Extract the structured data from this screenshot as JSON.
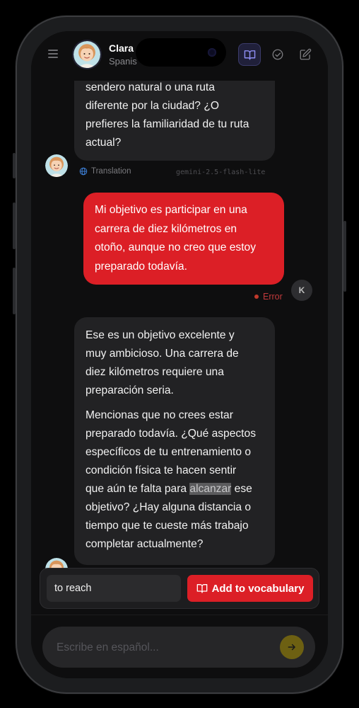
{
  "header": {
    "name": "Clara",
    "subtitle": "Spanis"
  },
  "messages": {
    "bot1": {
      "lines": [
        "sendero natural o una ruta",
        "diferente por la ciudad? ¿O",
        "prefieres la familiaridad de tu ruta",
        "actual?"
      ],
      "translation_label": "Translation",
      "model": "gemini-2.5-flash-lite"
    },
    "user1": {
      "lines": [
        "Mi objetivo es participar en una",
        "carrera de diez kilómetros en",
        "otoño, aunque no creo que estoy",
        "preparado todavía."
      ],
      "status": "Error",
      "avatar_initial": "K"
    },
    "bot2": {
      "paragraph1": [
        "Ese es un objetivo excelente y",
        "muy ambicioso. Una carrera de",
        "diez kilómetros requiere una",
        "preparación seria."
      ],
      "paragraph2_lines": [
        "Mencionas que no crees estar",
        "preparado todavía. ¿Qué aspectos",
        "específicos de tu entrenamiento o",
        "condición física te hacen sentir"
      ],
      "line_hl_before": "que aún te falta para ",
      "highlight": "alcanzar",
      "line_hl_after": " ese",
      "paragraph2_rest": [
        "objetivo? ¿Hay alguna distancia o",
        "tiempo que te cueste más trabajo",
        "completar actualmente?"
      ]
    }
  },
  "vocab": {
    "translation_value": "to reach",
    "add_label": "Add to vocabulary"
  },
  "composer": {
    "placeholder": "Escribe en español..."
  },
  "colors": {
    "accent_red": "#dc1f26",
    "send_button": "#6d6012",
    "error_dot": "#c0392b"
  }
}
